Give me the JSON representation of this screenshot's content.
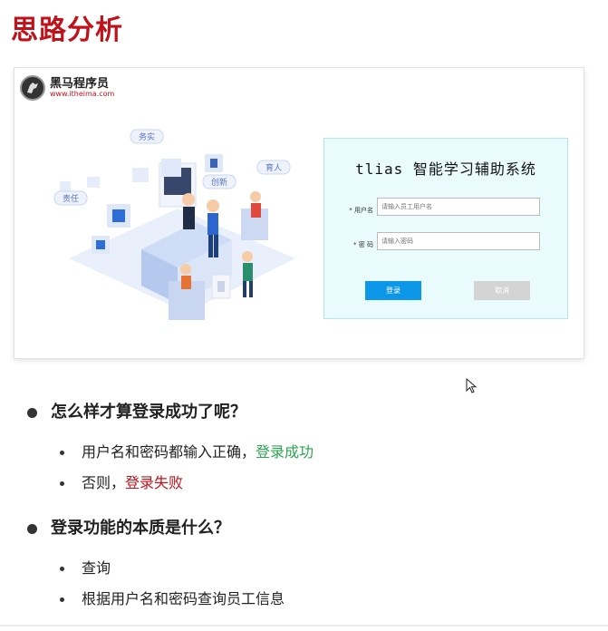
{
  "slide": {
    "title": "思路分析"
  },
  "brand": {
    "name": "黑马程序员",
    "url": "www.itheima.com"
  },
  "illustration": {
    "tag_1": "务实",
    "tag_2": "创新",
    "tag_3": "育人",
    "tag_4": "责任"
  },
  "login": {
    "system_title": "tlias 智能学习辅助系统",
    "username_label": "* 用户名",
    "username_placeholder": "请输入员工用户名",
    "password_label": "* 密  码",
    "password_placeholder": "请输入密码",
    "login_button": "登录",
    "cancel_button": "取消"
  },
  "questions": [
    {
      "text": "怎么样才算登录成功了呢？",
      "subs": [
        {
          "prefix": "用户名和密码都输入正确，",
          "highlight": "登录成功",
          "color": "#2aa64e"
        },
        {
          "prefix": "否则，",
          "highlight": "登录失败",
          "color": "#c0121b"
        }
      ]
    },
    {
      "text": "登录功能的本质是什么？",
      "subs": [
        {
          "prefix": "查询",
          "highlight": ""
        },
        {
          "prefix": "根据用户名和密码查询员工信息",
          "highlight": ""
        }
      ]
    }
  ]
}
